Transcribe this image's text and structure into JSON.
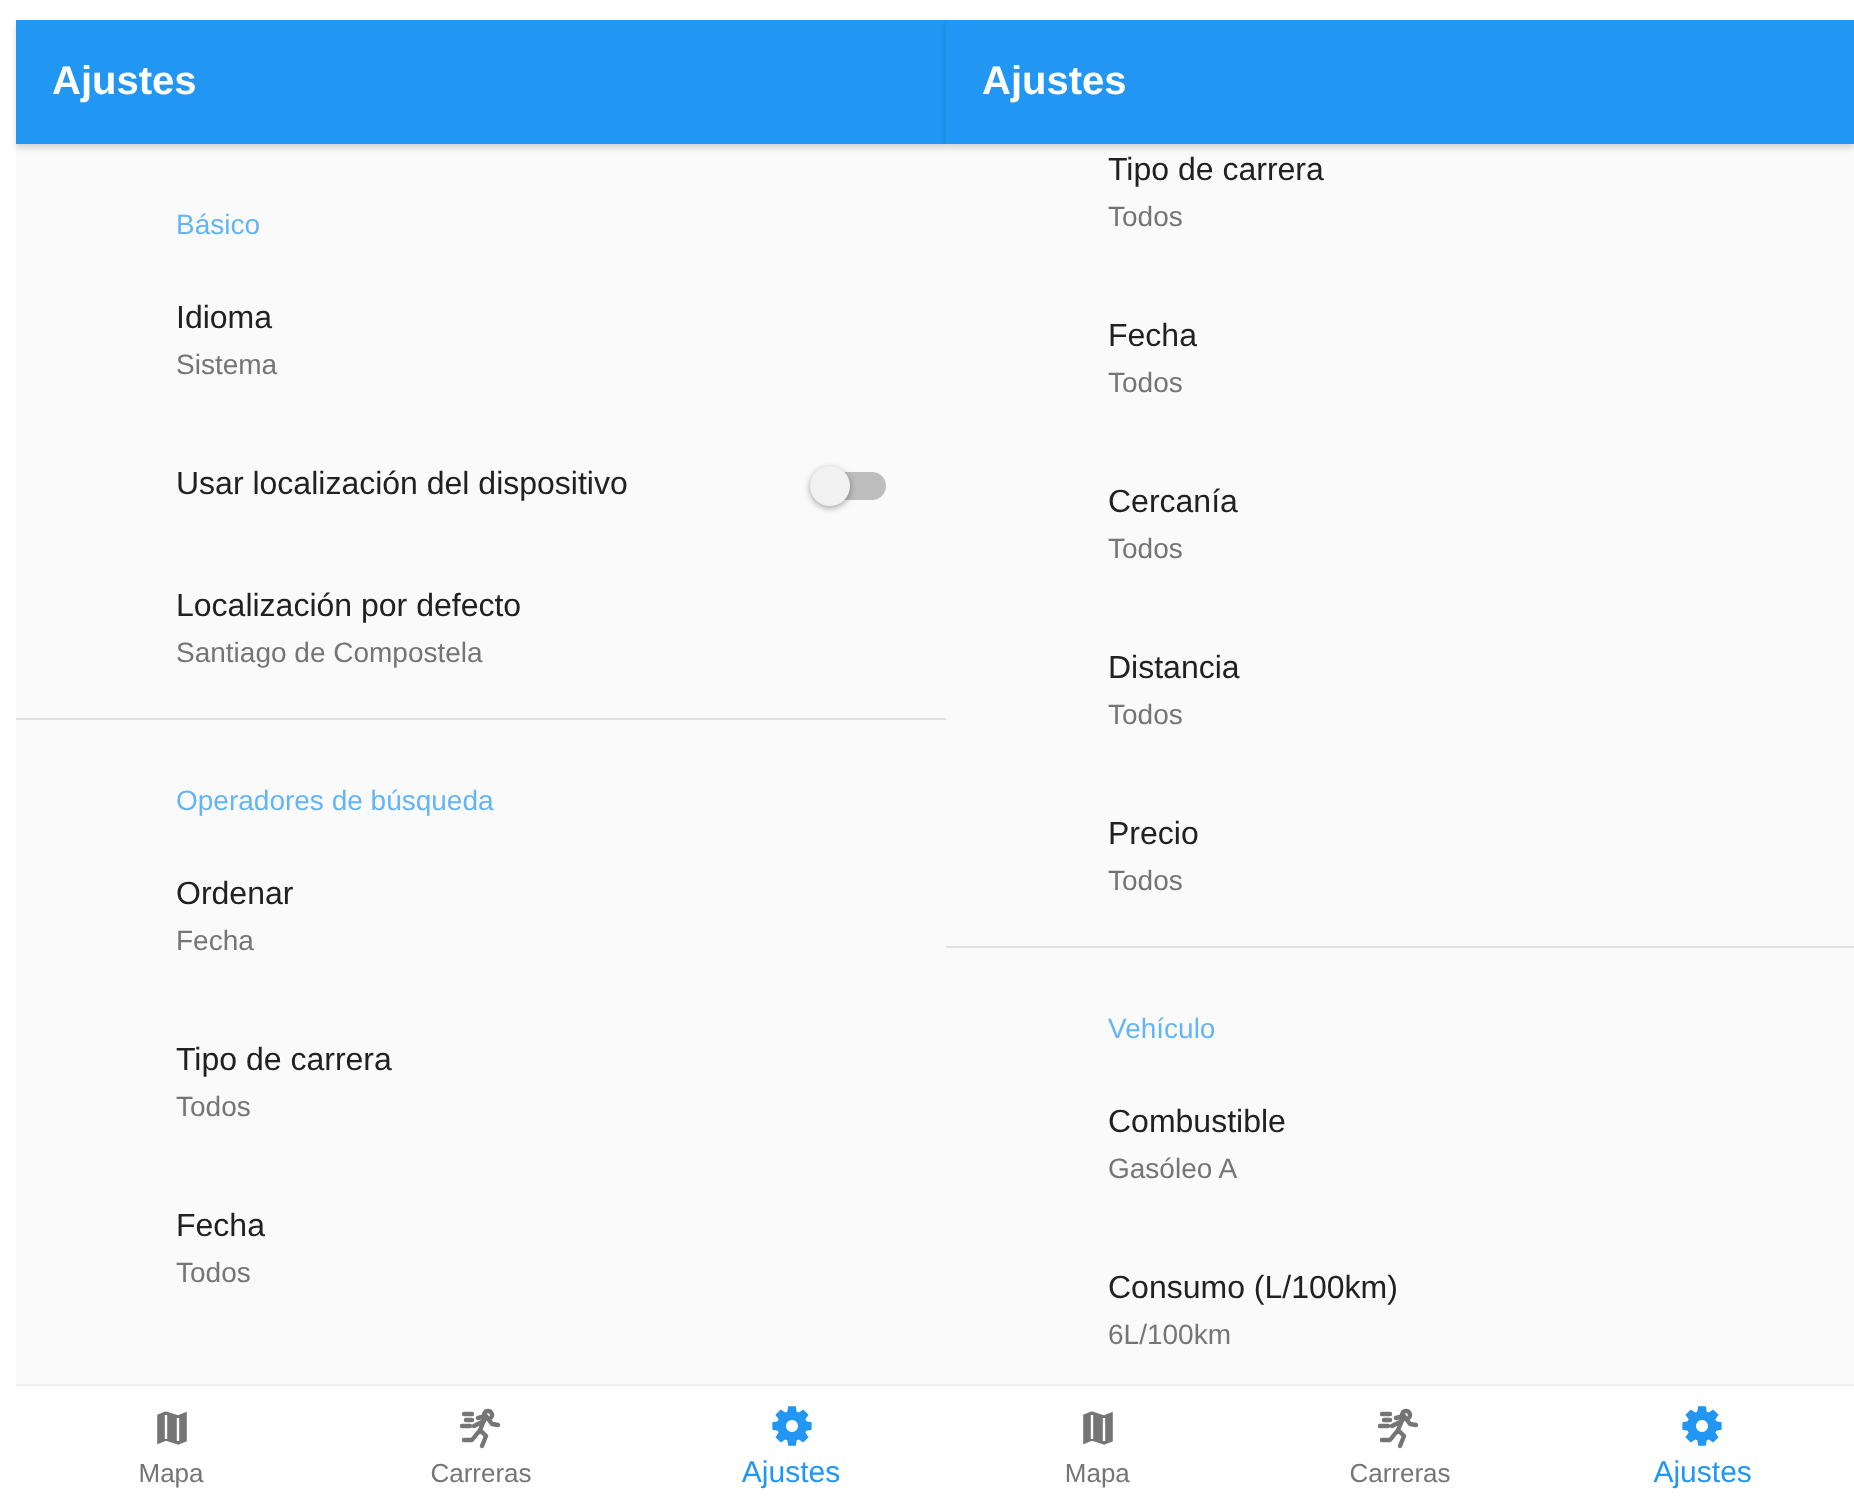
{
  "screens": [
    {
      "title": "Ajustes",
      "sections": [
        {
          "header": "Básico",
          "items": [
            {
              "kind": "summary",
              "title": "Idioma",
              "summary": "Sistema"
            },
            {
              "kind": "switch",
              "title": "Usar localización del dispositivo",
              "on": false
            },
            {
              "kind": "summary",
              "title": "Localización por defecto",
              "summary": "Santiago de Compostela"
            }
          ]
        },
        {
          "header": "Operadores de búsqueda",
          "items": [
            {
              "kind": "summary",
              "title": "Ordenar",
              "summary": "Fecha"
            },
            {
              "kind": "summary",
              "title": "Tipo de carrera",
              "summary": "Todos"
            },
            {
              "kind": "summary",
              "title": "Fecha",
              "summary": "Todos"
            }
          ]
        }
      ],
      "nav": [
        {
          "label": "Mapa",
          "kind": "map",
          "selected": false
        },
        {
          "label": "Carreras",
          "kind": "run",
          "selected": false
        },
        {
          "label": "Ajustes",
          "kind": "gear",
          "selected": true
        }
      ]
    },
    {
      "title": "Ajustes",
      "sections": [
        {
          "items": [
            {
              "kind": "summary",
              "title": "Tipo de carrera",
              "summary": "Todos"
            },
            {
              "kind": "summary",
              "title": "Fecha",
              "summary": "Todos"
            },
            {
              "kind": "summary",
              "title": "Cercanía",
              "summary": "Todos"
            },
            {
              "kind": "summary",
              "title": "Distancia",
              "summary": "Todos"
            },
            {
              "kind": "summary",
              "title": "Precio",
              "summary": "Todos"
            }
          ]
        },
        {
          "header": "Vehículo",
          "items": [
            {
              "kind": "summary",
              "title": "Combustible",
              "summary": "Gasóleo A"
            },
            {
              "kind": "summary",
              "title": "Consumo (L/100km)",
              "summary": "6L/100km"
            }
          ]
        }
      ],
      "nav": [
        {
          "label": "Mapa",
          "kind": "map",
          "selected": false
        },
        {
          "label": "Carreras",
          "kind": "run",
          "selected": false
        },
        {
          "label": "Ajustes",
          "kind": "gear",
          "selected": true
        }
      ]
    }
  ]
}
